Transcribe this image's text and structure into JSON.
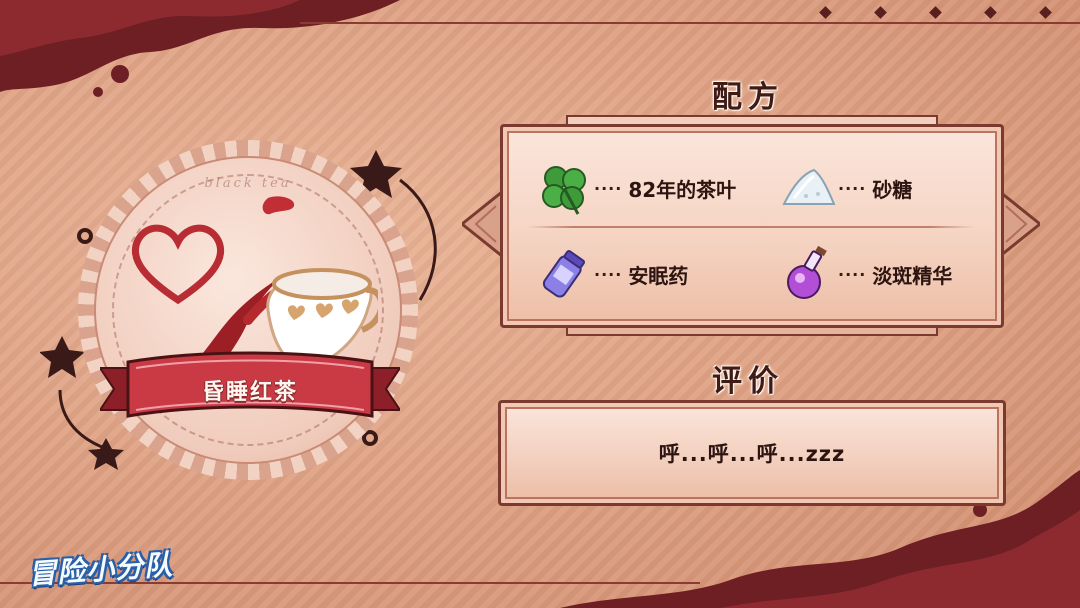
{
  "dish": {
    "name": "昏睡红茶",
    "caption": "black tea"
  },
  "recipe": {
    "heading": "配方",
    "ingredients": [
      {
        "dots": "····",
        "name": "82年的茶叶",
        "icon": "clover-icon"
      },
      {
        "dots": "····",
        "name": "砂糖",
        "icon": "sugar-pile-icon"
      },
      {
        "dots": "····",
        "name": "安眠药",
        "icon": "pill-bottle-icon"
      },
      {
        "dots": "····",
        "name": "淡斑精华",
        "icon": "potion-flask-icon"
      }
    ]
  },
  "review": {
    "heading": "评价",
    "text": "呼...呼...呼...zzz"
  },
  "logo": {
    "text": "冒险小分队"
  },
  "colors": {
    "background": "#e4a88b",
    "dark_wave": "#6e1f24",
    "ribbon": "#c93a45",
    "panel_border": "#7a3a2f",
    "heading_text": "#3e1b17"
  }
}
